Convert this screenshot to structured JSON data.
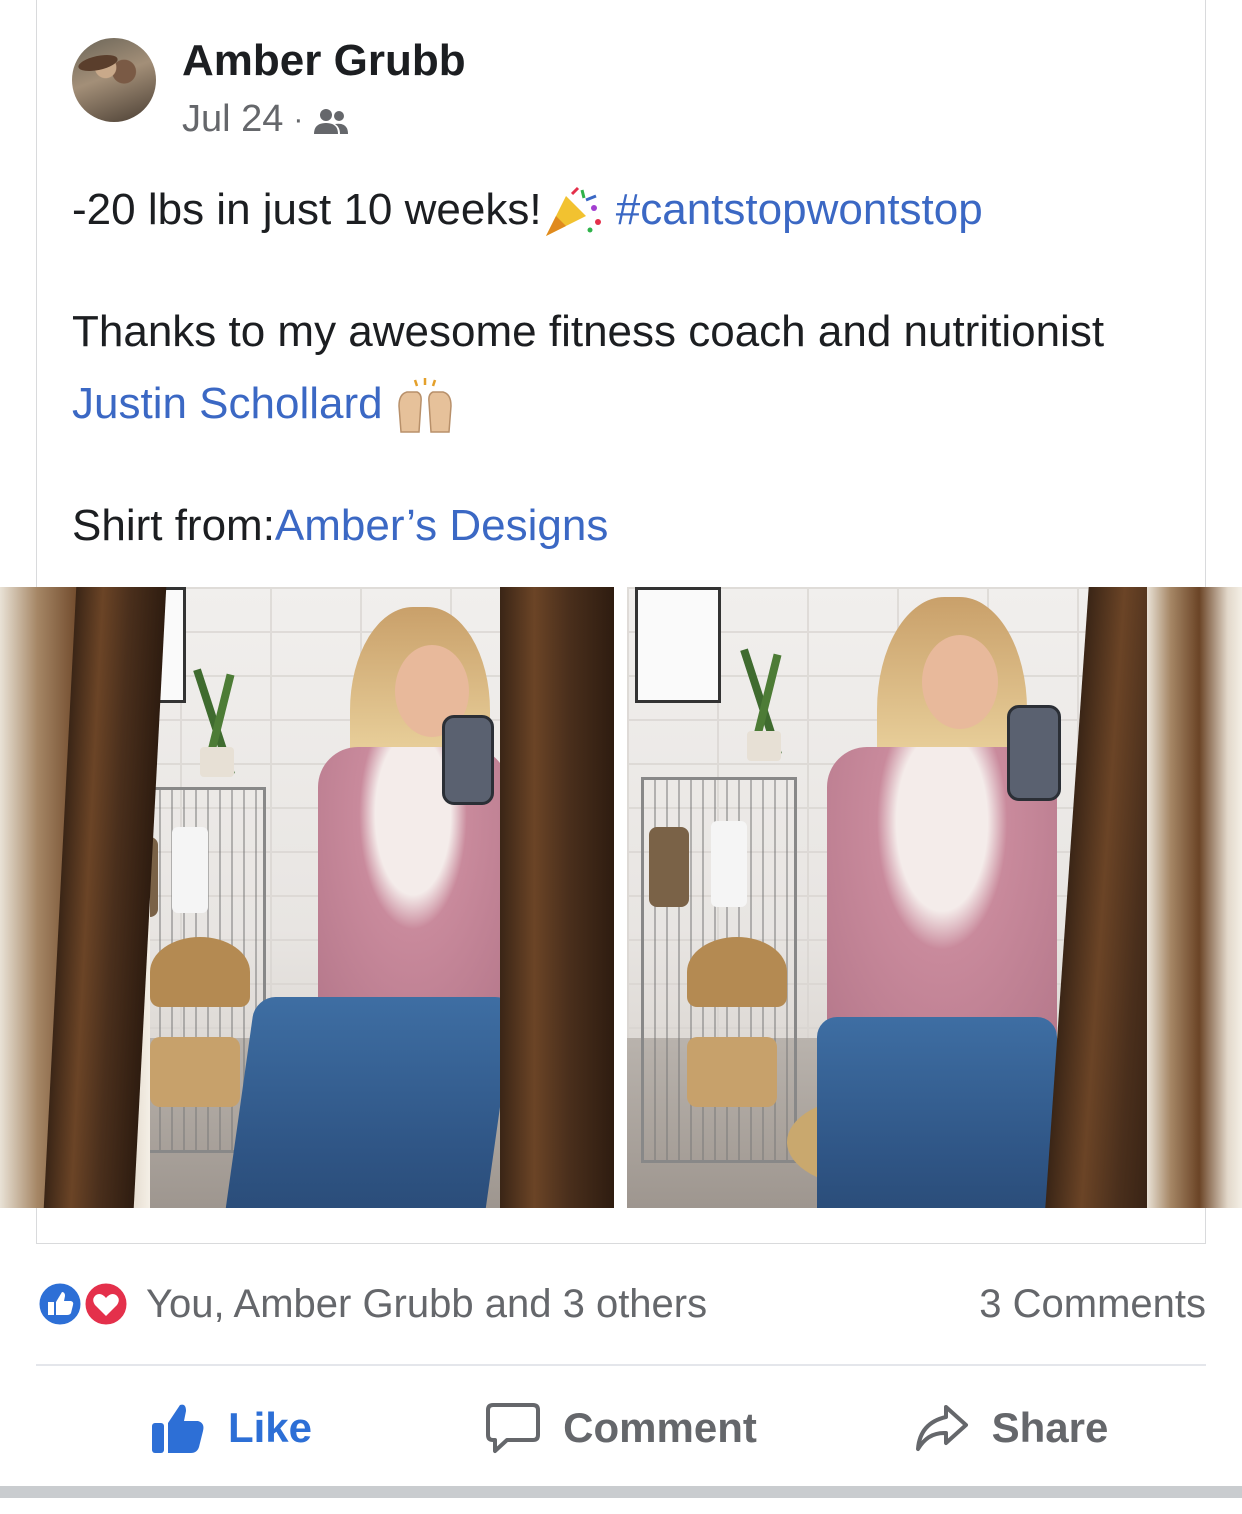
{
  "post": {
    "author": "Amber Grubb",
    "date": "Jul 24",
    "separator": "·",
    "audience_icon": "friends-icon",
    "line1_text": "-20 lbs in just 10 weeks!",
    "line1_emoji": "party-popper-icon",
    "hashtag": "#cantstopwontstop",
    "line2_text": "Thanks to my awesome fitness coach and nutritionist",
    "mention": "Justin Schollard",
    "mention_emoji": "raising-hands-icon",
    "line3_prefix": "Shirt from:",
    "line3_link": "Amber’s Designs"
  },
  "photos": [
    {
      "name": "photo-left"
    },
    {
      "name": "photo-right"
    }
  ],
  "reactions": {
    "icons": [
      "like-reaction-icon",
      "love-reaction-icon"
    ],
    "summary": "You, Amber Grubb and 3 others",
    "comments": "3 Comments"
  },
  "actions": {
    "like": "Like",
    "comment": "Comment",
    "share": "Share"
  },
  "colors": {
    "link": "#3b68c4",
    "like_blue": "#2d6fd6",
    "love_red": "#e4304b",
    "muted": "#65676b"
  }
}
